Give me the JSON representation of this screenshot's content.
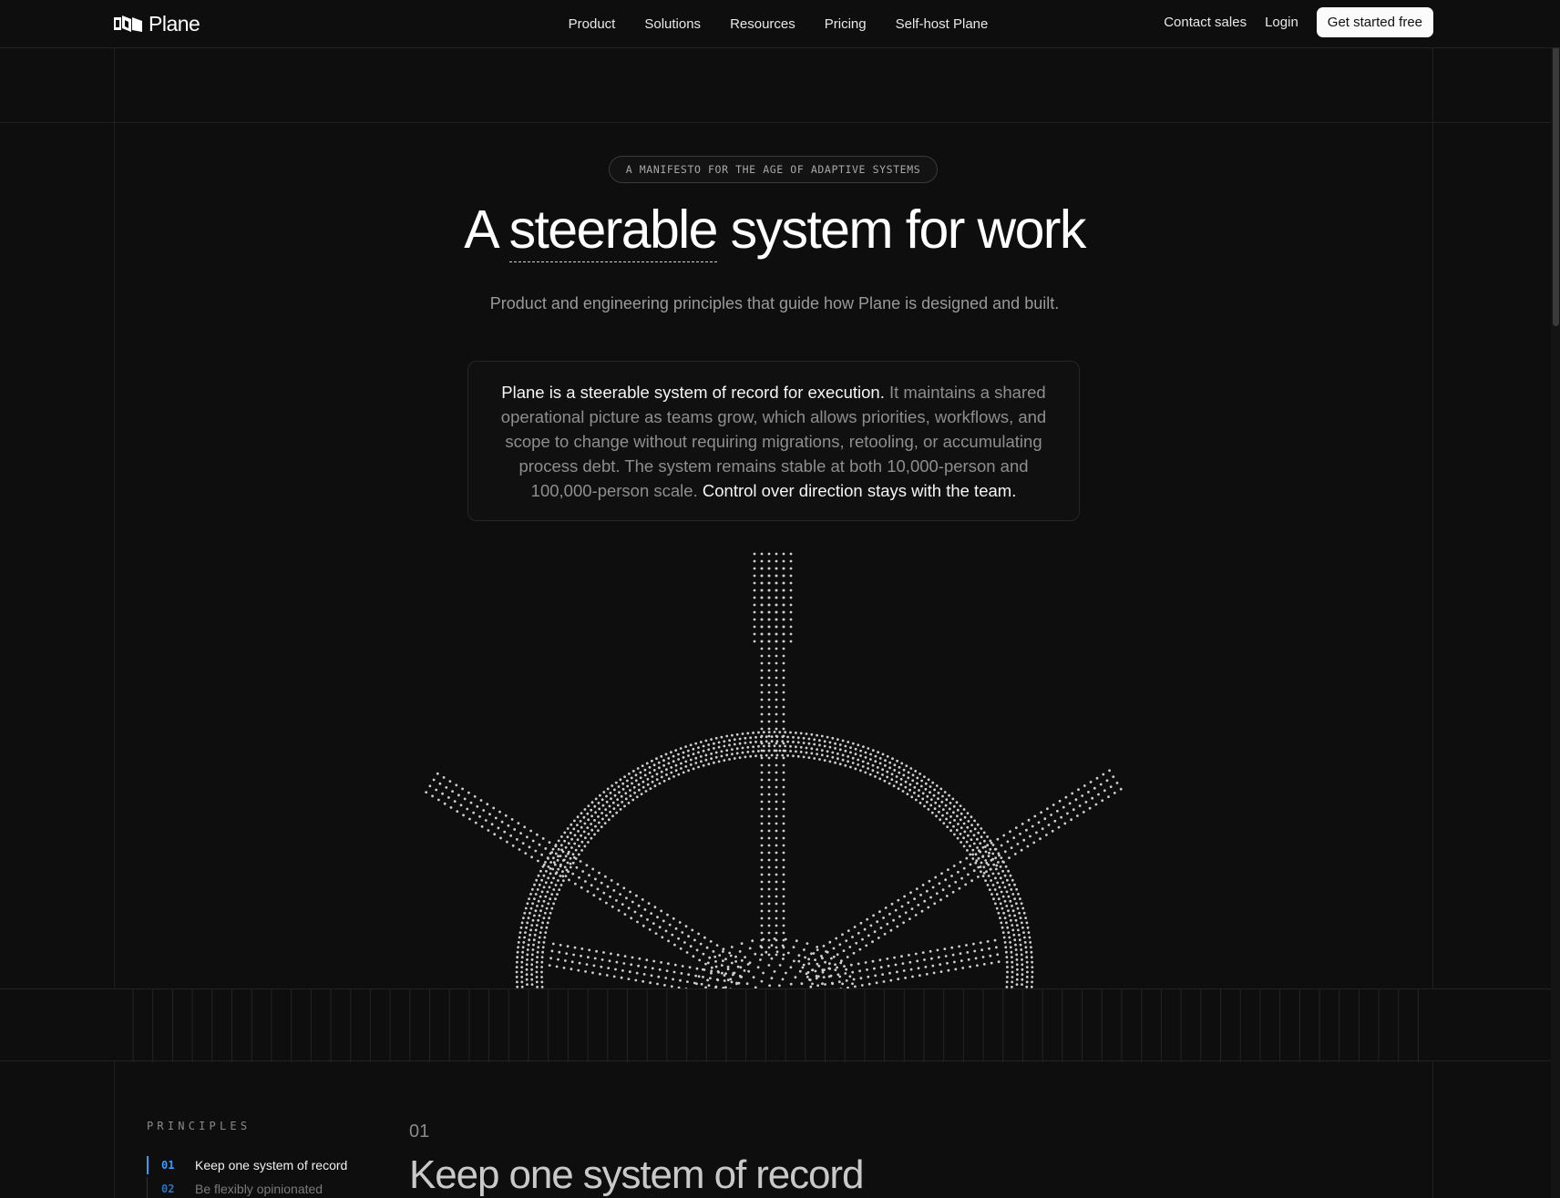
{
  "nav": {
    "brand": "Plane",
    "links": [
      "Product",
      "Solutions",
      "Resources",
      "Pricing",
      "Self-host Plane"
    ],
    "contact_label": "Contact sales",
    "login_label": "Login",
    "cta_label": "Get started free"
  },
  "hero": {
    "eyebrow": "A MANIFESTO FOR THE AGE OF ADAPTIVE SYSTEMS",
    "title_prefix": "A ",
    "title_underlined": "steerable",
    "title_suffix": " system for work",
    "subtitle": "Product and engineering principles that guide how Plane is designed and built.",
    "callout_lead": "Plane is a steerable system of record for execution.",
    "callout_body": " It maintains a shared operational picture as teams grow, which allows priorities, workflows, and scope to change without requiring migrations, retooling, or accumulating process debt. The system remains stable at both 10,000-person and 100,000-person scale. ",
    "callout_tail": "Control over direction stays with the team."
  },
  "principles": {
    "heading": "PRINCIPLES",
    "items": [
      {
        "num": "01",
        "label": "Keep one system of record"
      },
      {
        "num": "02",
        "label": "Be flexibly opinionated"
      }
    ],
    "current_num": "01",
    "current_title": "Keep one system of record"
  },
  "colors": {
    "background": "#0e0e0e",
    "accent": "#3b9bf5",
    "text": "#f2f2f2",
    "muted": "#8e8e8e"
  },
  "icons": {
    "logo": "plane-logo-icon",
    "illustration": "ship-wheel-icon"
  }
}
